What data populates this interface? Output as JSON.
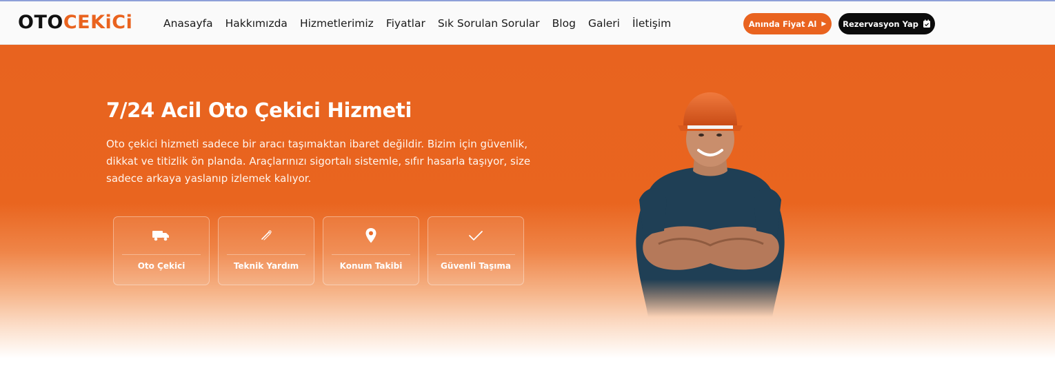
{
  "header": {
    "logo_part1": "OTO",
    "logo_part2": "CEKiCi",
    "nav": [
      "Anasayfa",
      "Hakkımızda",
      "Hizmetlerimiz",
      "Fiyatlar",
      "Sık Sorulan Sorular",
      "Blog",
      "Galeri",
      "İletişim"
    ],
    "quote_button": "Anında Fiyat Al",
    "reserve_button": "Rezervasyon Yap"
  },
  "hero": {
    "title": "7/24 Acil Oto Çekici Hizmeti",
    "description": "Oto çekici hizmeti sadece bir aracı taşımaktan ibaret değildir. Bizim için güvenlik, dikkat ve titizlik ön planda. Araçlarınızı sigortalı sistemle, sıfır hasarla taşıyor, size sadece arkaya yaslanıp izlemek kalıyor.",
    "features": [
      {
        "label": "Oto Çekici",
        "icon": "truck-icon"
      },
      {
        "label": "Teknik Yardım",
        "icon": "wrench-icon"
      },
      {
        "label": "Konum Takibi",
        "icon": "map-pin-icon"
      },
      {
        "label": "Güvenli Taşıma",
        "icon": "check-icon"
      }
    ]
  },
  "colors": {
    "brand_orange": "#e9631f",
    "dark": "#0b0b0b"
  }
}
